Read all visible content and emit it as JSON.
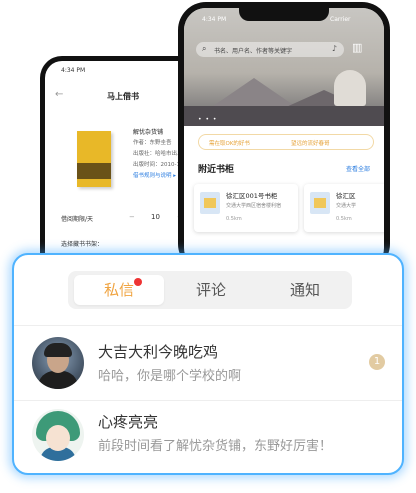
{
  "back_phone": {
    "status_time": "4:34 PM",
    "back_glyph": "←",
    "title": "马上借书",
    "book": {
      "name": "解忧杂货铺",
      "author": "作者：东野圭吾",
      "publisher": "出版社：哈哈市出...",
      "date": "出版时间：2010-1...",
      "link": "借书规则与说明 ▸"
    },
    "borrow_label": "借阅期限/天",
    "stepper_minus": "−",
    "stepper_value": "10",
    "stepper_plus": "+",
    "choose_label": "选择藏书书架："
  },
  "front_phone": {
    "status_time": "4:34 PM",
    "carrier": "Carrier",
    "search_icon": "⌕",
    "search_placeholder": "书名、用户名、作者等关键字",
    "mic_icon": "mic-icon",
    "menu_icon": "▥",
    "banner_dots": "• • •",
    "tags": [
      "需在取OK的好书",
      "望远的流好春哥"
    ],
    "section_title": "附近书柜",
    "section_more": "查看全部",
    "cards": [
      {
        "title": "徐汇区001号书柜",
        "address": "交通大学西区宿舍楼利宿",
        "distance": "0.5km"
      },
      {
        "title": "徐汇区",
        "address": "交通大学",
        "distance": "0.5km"
      }
    ]
  },
  "messages_panel": {
    "tabs": [
      {
        "label": "私信",
        "active": true,
        "has_dot": true
      },
      {
        "label": "评论",
        "active": false
      },
      {
        "label": "通知",
        "active": false
      }
    ],
    "messages": [
      {
        "name": "大吉大利今晚吃鸡",
        "preview": "哈哈，你是哪个学校的啊",
        "unread": "1"
      },
      {
        "name": "心疼亮亮",
        "preview": "前段时间看了解忧杂货铺，东野好厉害！"
      }
    ]
  }
}
